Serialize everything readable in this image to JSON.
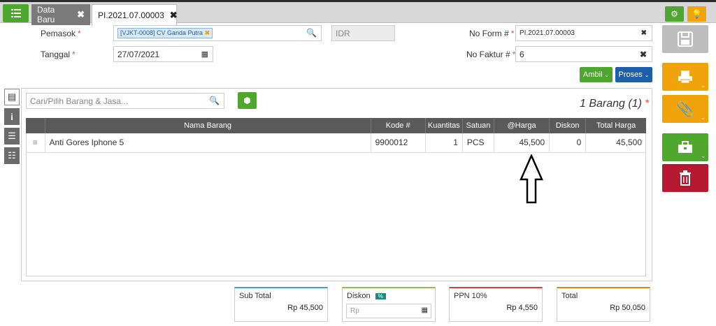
{
  "tabs": {
    "data_baru": "Data Baru",
    "active": "PI.2021.07.00003"
  },
  "form": {
    "pemasok_label": "Pemasok",
    "pemasok_value": "[VJKT-0008] CV Ganda Putra",
    "currency": "IDR",
    "tanggal_label": "Tanggal",
    "tanggal_value": "27/07/2021",
    "no_form_label": "No Form #",
    "no_form_value": "PI.2021.07.00003",
    "no_faktur_label": "No Faktur #",
    "no_faktur_value": "6",
    "required_mark": "*"
  },
  "actions": {
    "ambil": "Ambil",
    "proses": "Proses"
  },
  "items": {
    "search_placeholder": "Cari/Pilih Barang & Jasa...",
    "count_label": "1 Barang (1)",
    "columns": [
      "Nama Barang",
      "Kode #",
      "Kuantitas",
      "Satuan",
      "@Harga",
      "Diskon",
      "Total Harga"
    ],
    "rows": [
      {
        "nama": "Anti Gores Iphone 5",
        "kode": "9900012",
        "qty": "1",
        "satuan": "PCS",
        "harga": "45,500",
        "diskon": "0",
        "total": "45,500"
      }
    ]
  },
  "summary": {
    "sub_total_label": "Sub Total",
    "sub_total_value": "Rp 45,500",
    "diskon_label": "Diskon",
    "diskon_badge": "%",
    "diskon_placeholder": "Rp",
    "ppn_label": "PPN 10%",
    "ppn_value": "Rp 4,550",
    "total_label": "Total",
    "total_value": "Rp 50,050"
  },
  "colors": {
    "green": "#4fa72f",
    "orange": "#f0a30a",
    "blue": "#1d5fa8",
    "red": "#b5192f",
    "grey": "#bdbdbd"
  }
}
